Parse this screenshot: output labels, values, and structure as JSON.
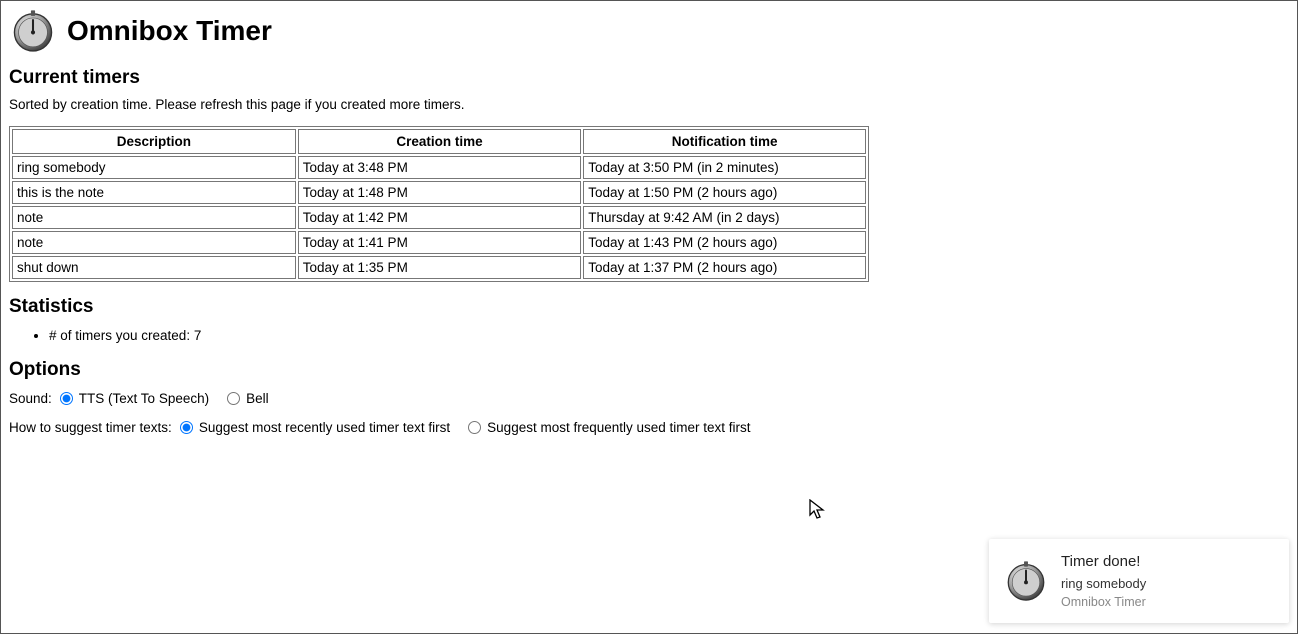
{
  "header": {
    "title": "Omnibox Timer"
  },
  "sections": {
    "current_timers": {
      "heading": "Current timers",
      "subtext": "Sorted by creation time. Please refresh this page if you created more timers.",
      "columns": {
        "description": "Description",
        "creation": "Creation time",
        "notification": "Notification time"
      },
      "rows": [
        {
          "desc": "ring somebody",
          "created": "Today at 3:48 PM",
          "notify": "Today at 3:50 PM (in 2 minutes)"
        },
        {
          "desc": "this is the note",
          "created": "Today at 1:48 PM",
          "notify": "Today at 1:50 PM (2 hours ago)"
        },
        {
          "desc": "note",
          "created": "Today at 1:42 PM",
          "notify": "Thursday at 9:42 AM (in 2 days)"
        },
        {
          "desc": "note",
          "created": "Today at 1:41 PM",
          "notify": "Today at 1:43 PM (2 hours ago)"
        },
        {
          "desc": "shut down",
          "created": "Today at 1:35 PM",
          "notify": "Today at 1:37 PM (2 hours ago)"
        }
      ]
    },
    "statistics": {
      "heading": "Statistics",
      "items": [
        "# of timers you created: 7"
      ]
    },
    "options": {
      "heading": "Options",
      "sound": {
        "label": "Sound:",
        "tts": "TTS (Text To Speech)",
        "bell": "Bell",
        "selected": "tts"
      },
      "suggest": {
        "label": "How to suggest timer texts:",
        "recent": "Suggest most recently used timer text first",
        "frequent": "Suggest most frequently used timer text first",
        "selected": "recent"
      }
    }
  },
  "toast": {
    "title": "Timer done!",
    "message": "ring somebody",
    "source": "Omnibox Timer"
  }
}
